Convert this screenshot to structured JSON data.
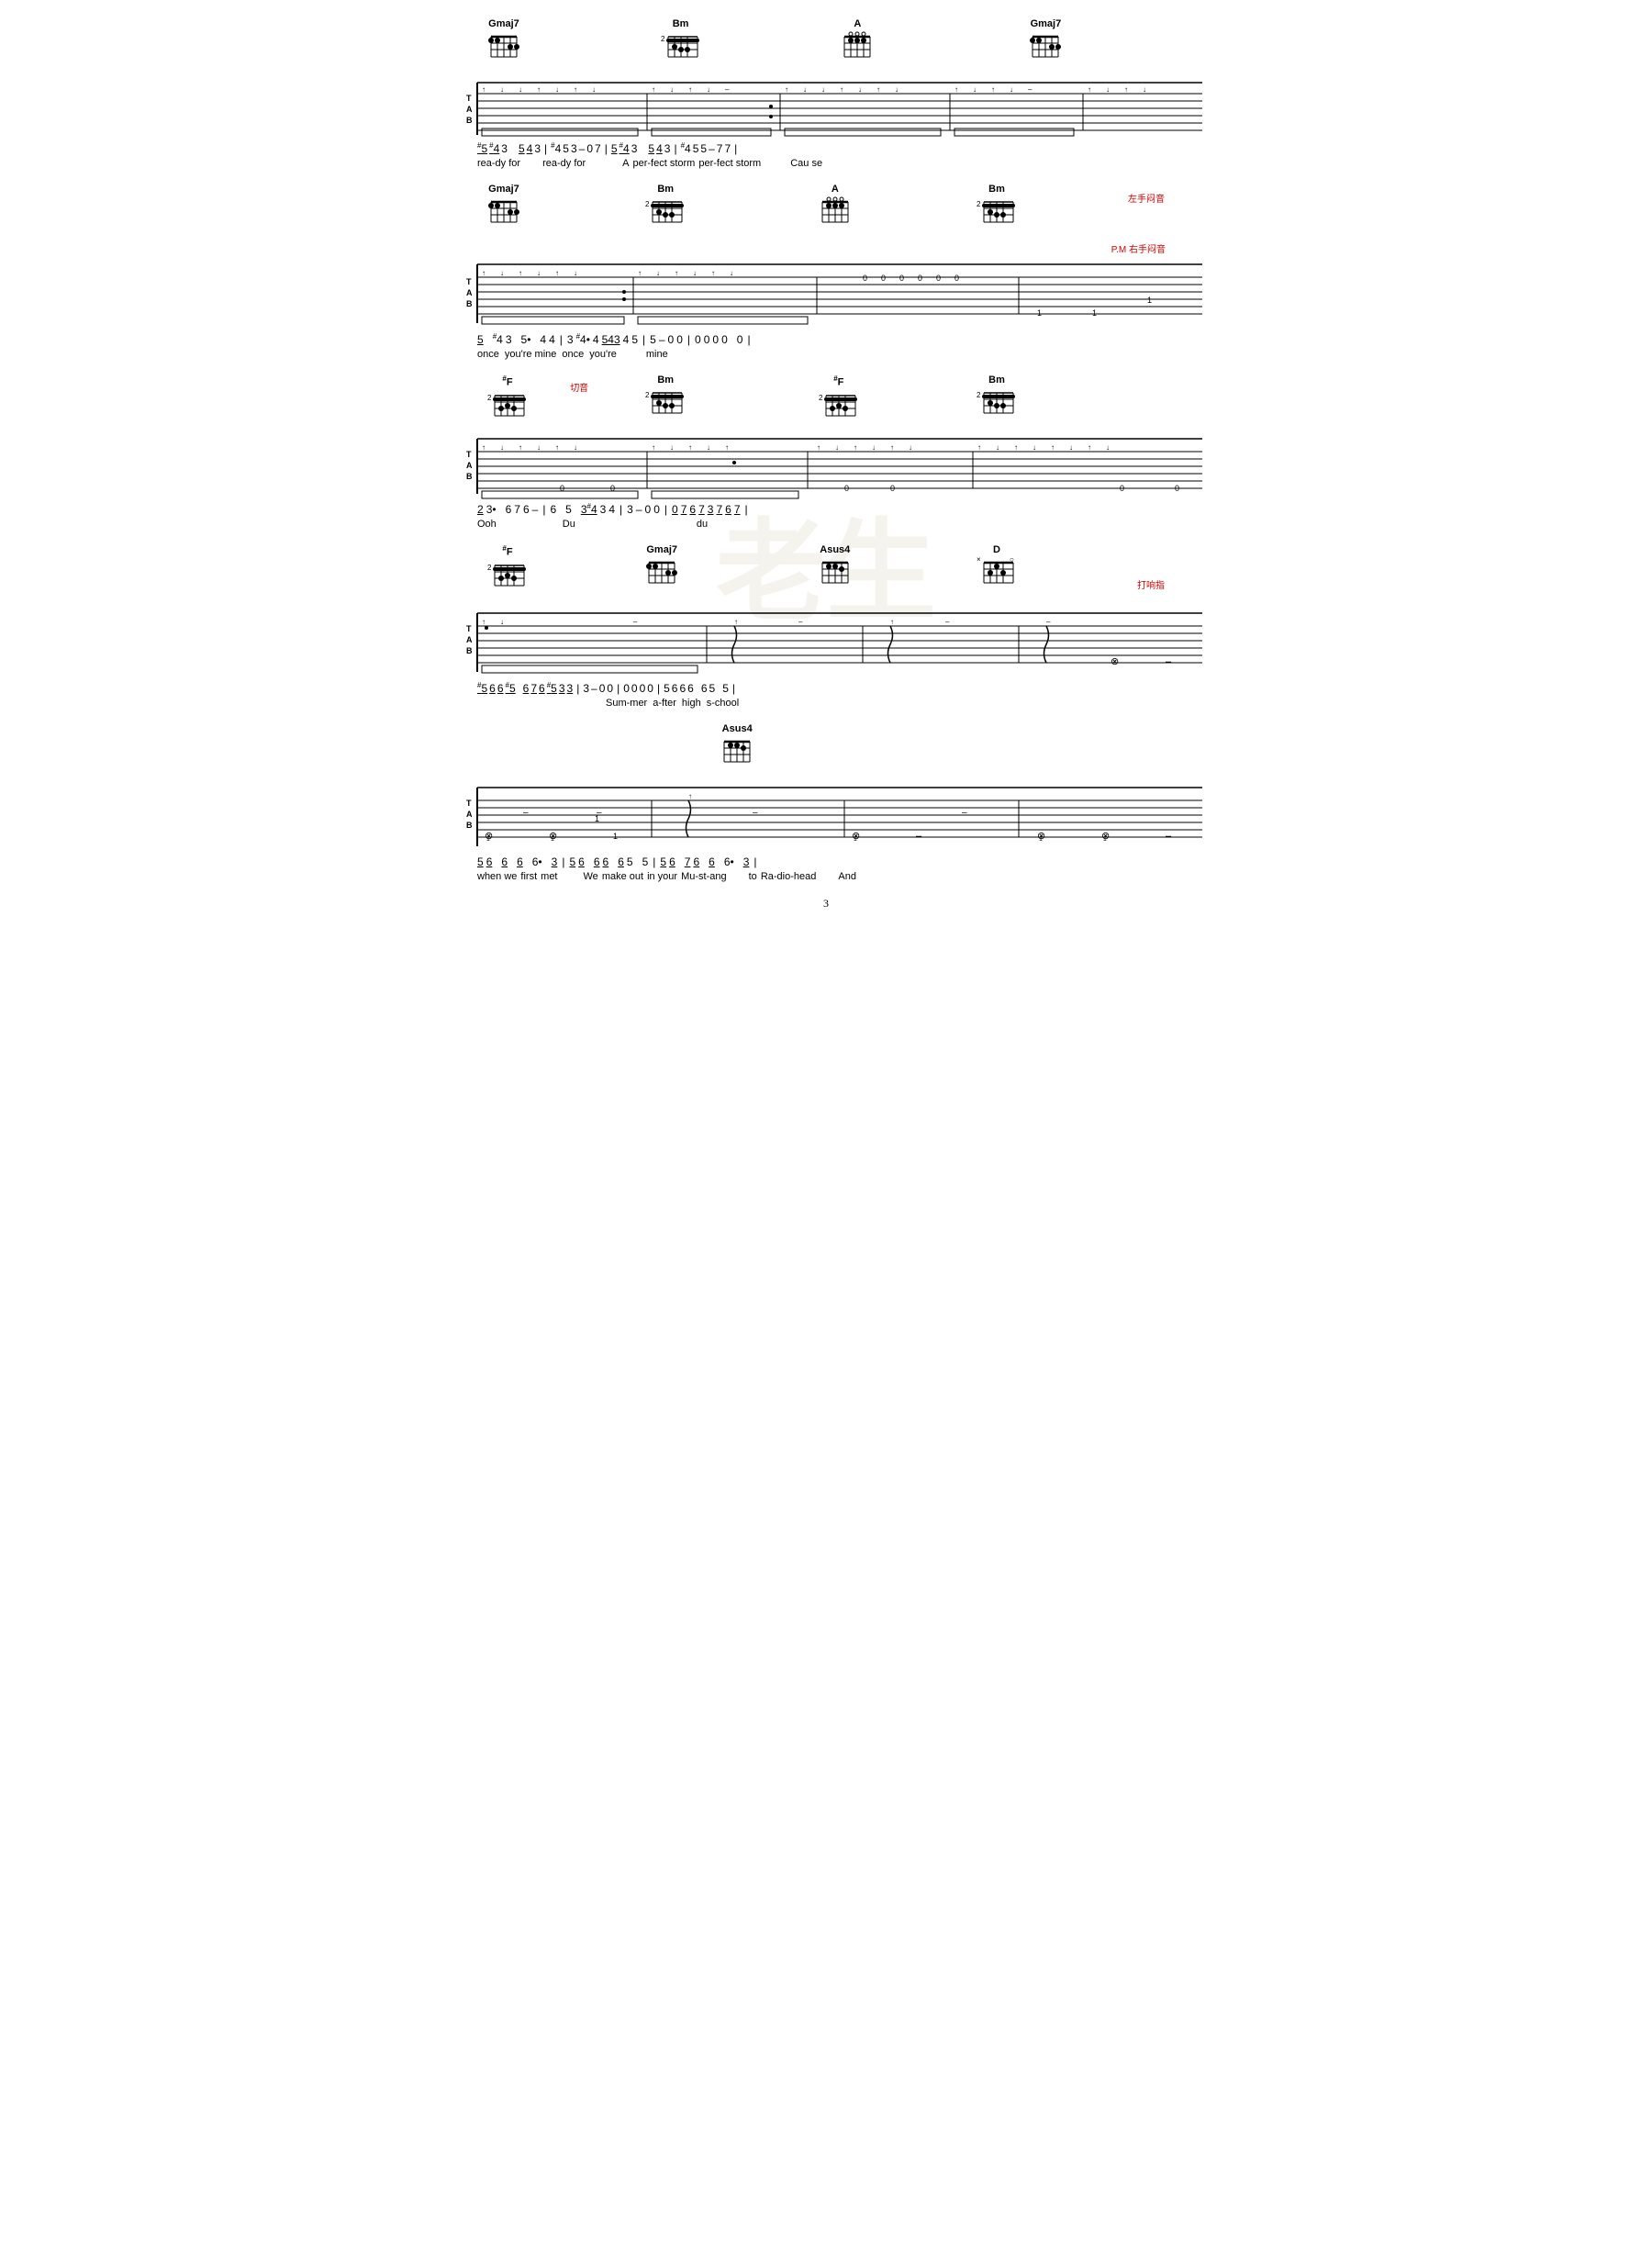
{
  "page": {
    "number": "3",
    "watermark": "老生"
  },
  "sections": [
    {
      "id": "section1",
      "chords": [
        {
          "name": "Gmaj7",
          "position": "10%",
          "fret": null
        },
        {
          "name": "Bm",
          "position": "32%",
          "fret": "2"
        },
        {
          "name": "A",
          "position": "55%",
          "fret": null
        },
        {
          "name": "Gmaj7",
          "position": "78%",
          "fret": null
        }
      ],
      "notation": "5 #4 3  5 4 3  | #4 5 3 - 0 7 | 5 #4 3  5 4 3  | #4 5 5 - 7 7 |",
      "lyrics": "rea-dy for  rea-dy for     A  per-fect storm per-fect storm    Cau se"
    },
    {
      "id": "section2",
      "chords": [
        {
          "name": "Gmaj7",
          "position": "8%",
          "fret": null
        },
        {
          "name": "Bm",
          "position": "28%",
          "fret": "2"
        },
        {
          "name": "A",
          "position": "50%",
          "fret": null
        },
        {
          "name": "Bm",
          "position": "72%",
          "fret": "2"
        }
      ],
      "annotations": [
        {
          "text": "左手闷音",
          "color": "red",
          "position": "65%"
        },
        {
          "text": "P.M 右手闷音",
          "color": "red",
          "position": "72%"
        }
      ],
      "notation": "5  #4 3  5•  4 4  | 3 #4• 4 543 4 5 | 5 - 0 0  | 0 0 0 0  0  |",
      "lyrics": "once  you're mine once  you're    mine"
    },
    {
      "id": "section3",
      "chords": [
        {
          "name": "#F",
          "position": "8%",
          "fret": "2"
        },
        {
          "name": "Bm",
          "position": "28%",
          "fret": "2"
        },
        {
          "name": "#F",
          "position": "50%",
          "fret": "2"
        },
        {
          "name": "Bm",
          "position": "72%",
          "fret": "2"
        }
      ],
      "annotations": [
        {
          "text": "切音",
          "color": "red",
          "position": "16%"
        }
      ],
      "notation": "2 3•  6 7 6 -  | 6  5  3#4 3 4 | 3 - 0 0  | 0 7 6 7 3 7 6 7 |",
      "lyrics": "Ooh                Du                    du"
    },
    {
      "id": "section4",
      "chords": [
        {
          "name": "#F",
          "position": "8%",
          "fret": "2"
        },
        {
          "name": "Gmaj7",
          "position": "28%",
          "fret": null
        },
        {
          "name": "Asus4",
          "position": "50%",
          "fret": null
        },
        {
          "name": "D",
          "position": "72%",
          "fret": null
        }
      ],
      "annotations": [
        {
          "text": "打响指",
          "color": "red",
          "position": "72%"
        }
      ],
      "notation": "#5 6 6 #5  6 7 6 #5 3 3  | 3 - 0 0  | 0 0 0 0  | 5 6 6 6  6 5  5  |",
      "lyrics": "Sum-mer  a-fter  high  s-chool"
    },
    {
      "id": "section5",
      "chords": [
        {
          "name": "Asus4",
          "position": "40%",
          "fret": null
        }
      ],
      "notation": "5 6  6  6  6•   3  | 5 6  6 6  6 5  5  | 5 6  7 6  6•   3  |",
      "lyrics": "when we  first  met    We  make out in your Mu-st-ang  to  Ra-dio-head   And"
    }
  ]
}
